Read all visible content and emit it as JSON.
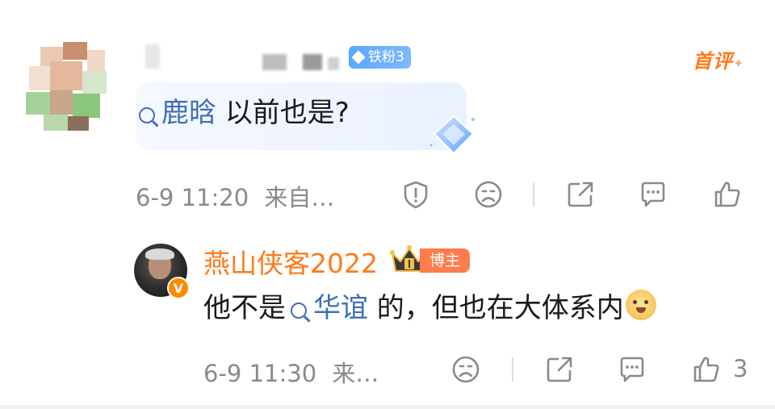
{
  "comment1": {
    "user_badge": "铁粉3",
    "first_tag": "首评",
    "topic": "鹿晗",
    "text": " 以前也是?",
    "time": "6-9 11:20",
    "source": "来自…",
    "icons": [
      "report-icon",
      "dislike-icon",
      "share-icon",
      "comment-icon",
      "like-icon"
    ]
  },
  "comment2": {
    "author": "燕山侠客2022",
    "role_badge": "博主",
    "verified_mark": "V",
    "text_before": "他不是",
    "topic": "华谊",
    "text_after": " 的，但也在大体系内",
    "time": "6-9 11:30",
    "source": "来…",
    "like_count": "3",
    "icons": [
      "dislike-icon",
      "share-icon",
      "comment-icon",
      "like-icon"
    ]
  },
  "colors": {
    "accent_orange": "#ff7a1a",
    "topic_blue": "#3f6fb6",
    "meta_gray": "#8a8a8a",
    "fan_badge_blue": "#5aa7ff"
  }
}
